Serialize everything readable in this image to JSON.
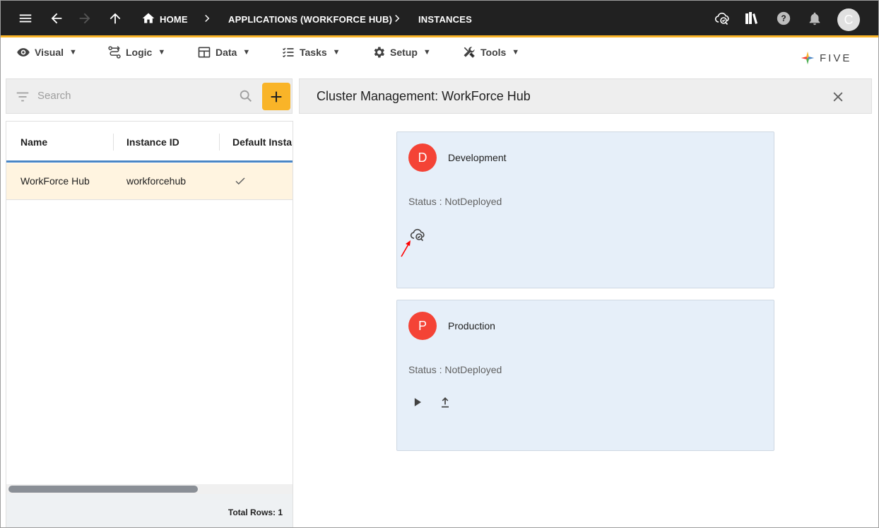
{
  "topbar": {
    "breadcrumbs": [
      "HOME",
      "APPLICATIONS (WORKFORCE HUB)",
      "INSTANCES"
    ],
    "avatar_initial": "C",
    "icons": [
      "menu-icon",
      "back-arrow-icon",
      "forward-arrow-icon",
      "up-arrow-icon",
      "home-icon",
      "cloud-check-icon",
      "library-icon",
      "help-icon",
      "bell-icon"
    ]
  },
  "menu": {
    "items": [
      {
        "label": "Visual",
        "icon": "eye-icon"
      },
      {
        "label": "Logic",
        "icon": "logic-icon"
      },
      {
        "label": "Data",
        "icon": "table-icon"
      },
      {
        "label": "Tasks",
        "icon": "checklist-icon"
      },
      {
        "label": "Setup",
        "icon": "gear-icon"
      },
      {
        "label": "Tools",
        "icon": "tools-icon"
      }
    ],
    "caret": "▼",
    "logo_text": "FIVE"
  },
  "list": {
    "search_placeholder": "Search",
    "columns": [
      "Name",
      "Instance ID",
      "Default Instance"
    ],
    "rows": [
      {
        "name": "WorkForce Hub",
        "instance_id": "workforcehub",
        "default": true
      }
    ],
    "footer": "Total Rows: 1"
  },
  "panel": {
    "title": "Cluster Management: WorkForce Hub",
    "cards": [
      {
        "initial": "D",
        "name": "Development",
        "status": "Status : NotDeployed",
        "actions": [
          "cloud-check-icon"
        ]
      },
      {
        "initial": "P",
        "name": "Production",
        "status": "Status : NotDeployed",
        "actions": [
          "play-icon",
          "upload-icon"
        ]
      }
    ]
  },
  "colors": {
    "topbar_bg": "#212121",
    "accent": "#f9b428",
    "selected_row": "#fff4e0",
    "card_bg": "#e6eff9",
    "avatar_red": "#f44336",
    "header_underline": "#4a86c5",
    "annotation_arrow": "#ff0000"
  }
}
